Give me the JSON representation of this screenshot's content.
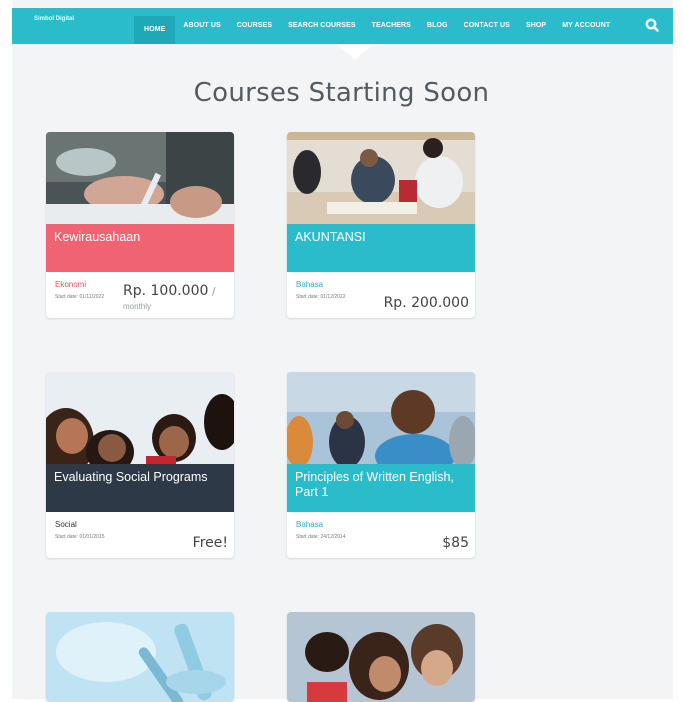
{
  "header": {
    "logo": "Simbol Digital",
    "nav": [
      "HOME",
      "ABOUT US",
      "COURSES",
      "SEARCH COURSES",
      "TEACHERS",
      "BLOG",
      "CONTACT US",
      "SHOP",
      "MY ACCOUNT"
    ],
    "active_index": 0
  },
  "main": {
    "title": "Courses Starting Soon",
    "courses": [
      {
        "title": "Kewirausahaan",
        "category": "Ekonomi",
        "start": "Start date: 01/11/2022",
        "price": "Rp. 100.000",
        "price_suffix": " /",
        "price_sub": "monthly",
        "band_color": "#f06373",
        "category_color": "#e8505b"
      },
      {
        "title": "AKUNTANSI",
        "category": "Bahasa",
        "start": "Start date: 01/12/2022",
        "price": "Rp. 200.000",
        "price_suffix": "",
        "price_sub": "",
        "band_color": "#2bbccc",
        "category_color": "#2bb0c4"
      },
      {
        "title": "Evaluating Social Programs",
        "category": "Social",
        "start": "Start date: 01/01/2015",
        "price": "Free!",
        "price_suffix": "",
        "price_sub": "",
        "band_color": "#2d3946",
        "category_color": "#333333"
      },
      {
        "title": "Principles of Written English, Part 1",
        "category": "Bahasa",
        "start": "Start date: 24/12/2014",
        "price": "$85",
        "price_suffix": "",
        "price_sub": "",
        "band_color": "#2bbccc",
        "category_color": "#2bb0c4"
      }
    ]
  }
}
